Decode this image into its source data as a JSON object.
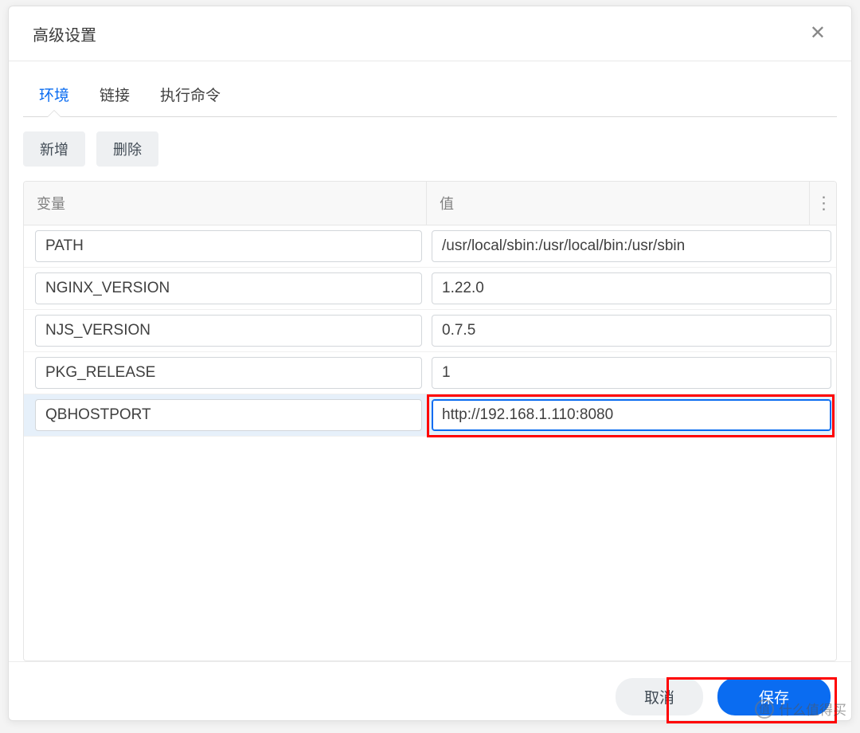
{
  "dialog": {
    "title": "高级设置"
  },
  "tabs": [
    {
      "label": "环境",
      "active": true
    },
    {
      "label": "链接",
      "active": false
    },
    {
      "label": "执行命令",
      "active": false
    }
  ],
  "toolbar": {
    "add_label": "新增",
    "delete_label": "删除"
  },
  "grid": {
    "header_variable": "变量",
    "header_value": "值",
    "rows": [
      {
        "variable": "PATH",
        "value": "/usr/local/sbin:/usr/local/bin:/usr/sbin",
        "selected": false,
        "focused": false
      },
      {
        "variable": "NGINX_VERSION",
        "value": "1.22.0",
        "selected": false,
        "focused": false
      },
      {
        "variable": "NJS_VERSION",
        "value": "0.7.5",
        "selected": false,
        "focused": false
      },
      {
        "variable": "PKG_RELEASE",
        "value": "1",
        "selected": false,
        "focused": false
      },
      {
        "variable": "QBHOSTPORT",
        "value": "http://192.168.1.110:8080",
        "selected": true,
        "focused": true
      }
    ]
  },
  "footer": {
    "cancel_label": "取消",
    "save_label": "保存"
  },
  "watermark": {
    "badge": "值",
    "text": "什么值得买"
  }
}
